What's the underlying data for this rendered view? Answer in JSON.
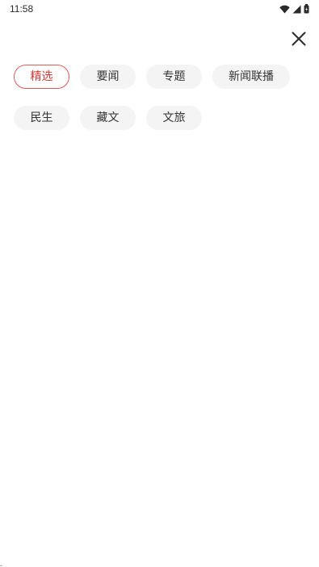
{
  "status_bar": {
    "time": "11:58",
    "icons": [
      "wifi-icon",
      "cellular-signal-icon",
      "battery-icon"
    ]
  },
  "close_button": {
    "icon": "close-icon"
  },
  "categories": {
    "selected_index": 0,
    "accent_color": "#d93a3a",
    "rows": [
      [
        {
          "label": "精选",
          "selected": true
        },
        {
          "label": "要闻",
          "selected": false
        },
        {
          "label": "专题",
          "selected": false
        },
        {
          "label": "新闻联播",
          "selected": false
        }
      ],
      [
        {
          "label": "民生",
          "selected": false
        },
        {
          "label": "藏文",
          "selected": false
        },
        {
          "label": "文旅",
          "selected": false
        }
      ]
    ]
  }
}
